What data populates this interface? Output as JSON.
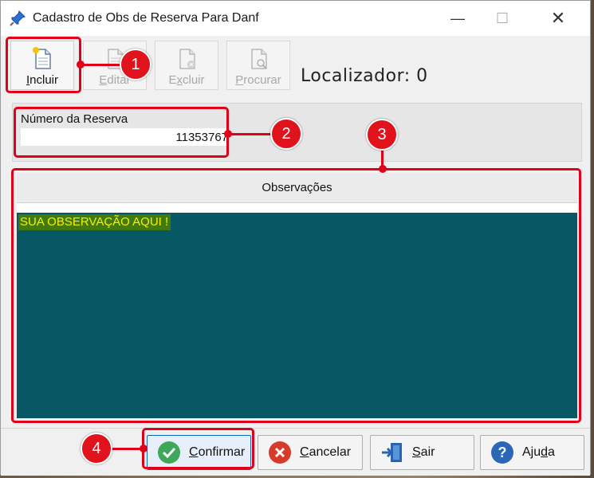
{
  "window": {
    "title": "Cadastro de Obs de Reserva Para Danf",
    "minimize": "—",
    "maximize": "☐",
    "close": "✕"
  },
  "toolbar": {
    "incluir": {
      "prefix": "",
      "mnemonic": "I",
      "rest": "ncluir"
    },
    "editar": {
      "prefix": "",
      "mnemonic": "E",
      "rest": "ditar"
    },
    "excluir": {
      "prefix": "E",
      "mnemonic": "x",
      "rest": "cluir"
    },
    "procurar": {
      "prefix": "",
      "mnemonic": "P",
      "rest": "rocurar"
    },
    "localizador": "Localizador: 0"
  },
  "reserva": {
    "label": "Número da Reserva",
    "value": "11353767"
  },
  "observacoes": {
    "header": "Observações",
    "text": "SUA OBSERVAÇÃO AQUI !"
  },
  "buttons": {
    "confirmar": {
      "prefix": "",
      "mnemonic": "C",
      "rest": "onfirmar"
    },
    "cancelar": {
      "prefix": "",
      "mnemonic": "C",
      "rest": "ancelar"
    },
    "sair": {
      "prefix": "",
      "mnemonic": "S",
      "rest": "air"
    },
    "ajuda": {
      "prefix": "Aju",
      "mnemonic": "d",
      "rest": "a"
    }
  },
  "annotations": [
    "1",
    "2",
    "3",
    "4"
  ],
  "colors": {
    "annotation": "#e0001a",
    "obs_background": "#075765",
    "obs_text": "#f6f000",
    "obs_highlight": "#437a10"
  }
}
